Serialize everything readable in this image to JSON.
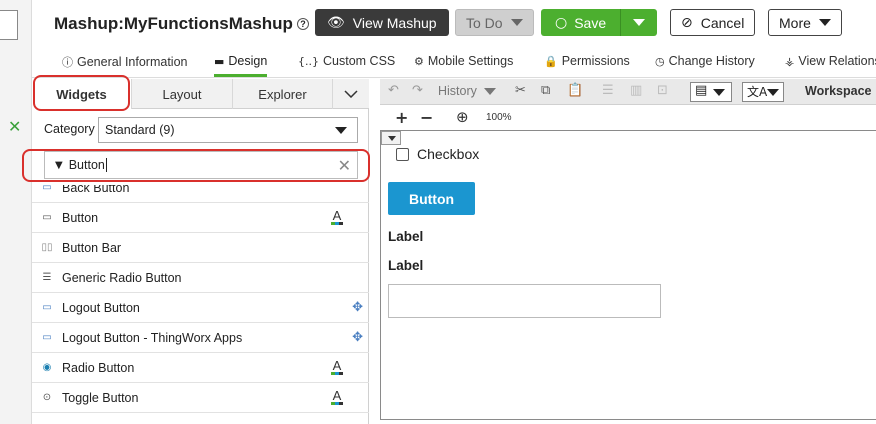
{
  "header": {
    "title_prefix": "Mashup:",
    "title_name": "MyFunctionsMashup",
    "help_icon": "help-circle-icon",
    "view_mashup_label": "View Mashup",
    "todo_label": "To Do",
    "save_label": "Save",
    "cancel_label": "Cancel",
    "more_label": "More"
  },
  "tabs": [
    {
      "label": "General Information",
      "icon": "info-icon"
    },
    {
      "label": "Design",
      "icon": "layout-icon",
      "active": true
    },
    {
      "label": "Custom CSS",
      "icon": "css-icon"
    },
    {
      "label": "Mobile Settings",
      "icon": "gear-icon"
    },
    {
      "label": "Permissions",
      "icon": "lock-icon"
    },
    {
      "label": "Change History",
      "icon": "clock-icon"
    },
    {
      "label": "View Relations",
      "icon": "relations-icon"
    }
  ],
  "panel": {
    "tabs": [
      "Widgets",
      "Layout",
      "Explorer"
    ],
    "category_label": "Category",
    "category_value": "Standard (9)",
    "filter_value": "Button",
    "widgets": [
      {
        "label": "Back Button",
        "icon": "button-icon"
      },
      {
        "label": "Button",
        "icon": "cursor-button-icon",
        "badge": "localizable"
      },
      {
        "label": "Button Bar",
        "icon": "button-bar-icon"
      },
      {
        "label": "Generic Radio Button",
        "icon": "list-icon"
      },
      {
        "label": "Logout Button",
        "icon": "button-icon",
        "badge": "responsive"
      },
      {
        "label": "Logout Button - ThingWorx Apps",
        "icon": "button-icon",
        "badge": "responsive"
      },
      {
        "label": "Radio Button",
        "icon": "radio-icon",
        "badge": "localizable"
      },
      {
        "label": "Toggle Button",
        "icon": "toggle-icon",
        "badge": "localizable"
      }
    ]
  },
  "toolbar": {
    "history_label": "History",
    "workspace_label": "Workspace",
    "zoom_level": "100%"
  },
  "canvas": {
    "checkbox_label": "Checkbox",
    "button_label": "Button",
    "label1": "Label",
    "label2": "Label"
  },
  "colors": {
    "save_green": "#4caf2f",
    "canvas_button_blue": "#1b96d0",
    "highlight_red": "#d9302c",
    "dark_button": "#3a3a3a"
  }
}
